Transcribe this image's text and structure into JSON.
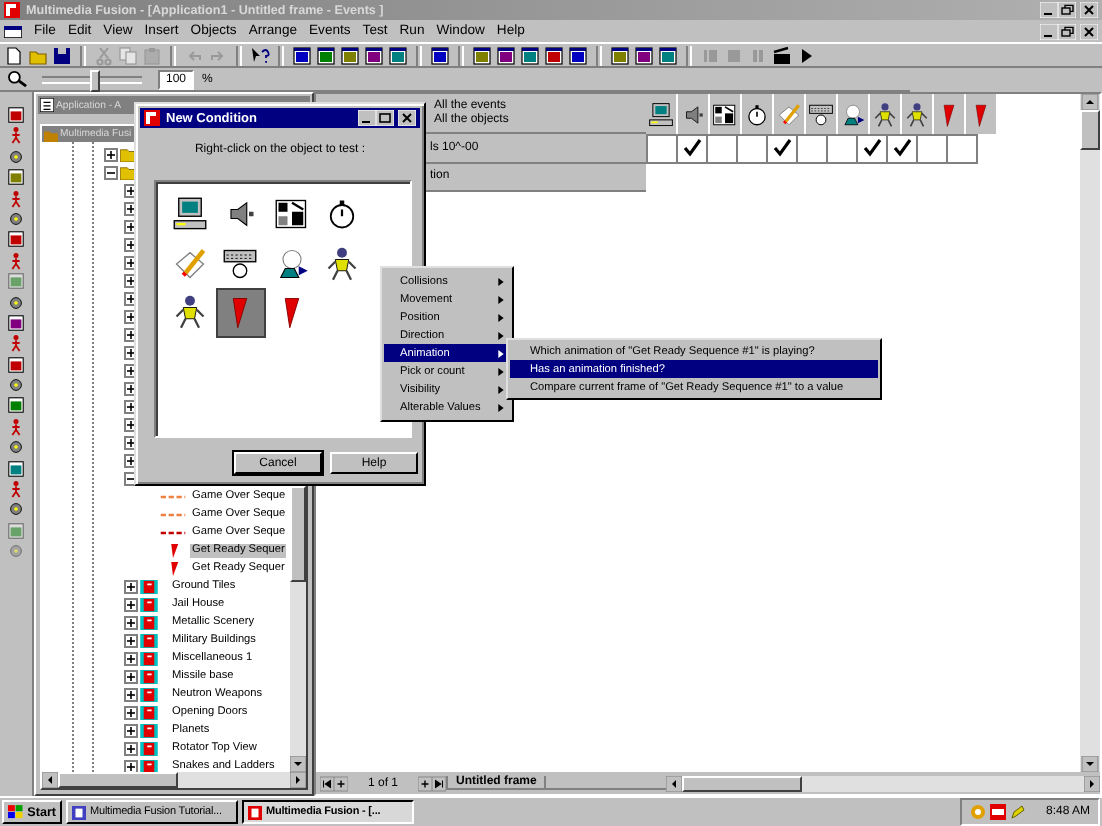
{
  "window": {
    "title": "Multimedia Fusion - [Application1 - Untitled frame - Events ]"
  },
  "menu": [
    "File",
    "Edit",
    "View",
    "Insert",
    "Objects",
    "Arrange",
    "Events",
    "Test",
    "Run",
    "Window",
    "Help"
  ],
  "zoom": {
    "level": 0.52,
    "value": "100",
    "unit": "%"
  },
  "app_window": {
    "title": "Application - A",
    "inner_title": "Multimedia Fusi",
    "tree": [
      {
        "expanded": false
      },
      {
        "expanded": true,
        "children": [
          {
            "expanded": false
          },
          {
            "expanded": false
          },
          {
            "expanded": false
          },
          {
            "expanded": false
          },
          {
            "expanded": false
          },
          {
            "expanded": false
          },
          {
            "expanded": false
          },
          {
            "expanded": false
          },
          {
            "expanded": false
          },
          {
            "expanded": false
          },
          {
            "expanded": false
          },
          {
            "expanded": false
          },
          {
            "expanded": false
          },
          {
            "expanded": false
          },
          {
            "expanded": false
          },
          {
            "expanded": false
          },
          {
            "expanded": true,
            "children": [
              {
                "label": "Game Over Seque",
                "selected": false
              },
              {
                "label": "Game Over Seque",
                "selected": false
              },
              {
                "label": "Game Over Seque",
                "selected": false
              },
              {
                "label": "Get Ready Sequer",
                "selected": true
              },
              {
                "label": "Get Ready Sequer",
                "selected": false
              }
            ]
          },
          {
            "label": "Ground Tiles",
            "expanded": false
          },
          {
            "label": "Jail House",
            "expanded": false
          },
          {
            "label": "Metallic Scenery",
            "expanded": false
          },
          {
            "label": "Military Buildings",
            "expanded": false
          },
          {
            "label": "Miscellaneous 1",
            "expanded": false
          },
          {
            "label": "Missile base",
            "expanded": false
          },
          {
            "label": "Neutron Weapons",
            "expanded": false
          },
          {
            "label": "Opening Doors",
            "expanded": false
          },
          {
            "label": "Planets",
            "expanded": false
          },
          {
            "label": "Rotator Top View",
            "expanded": false
          },
          {
            "label": "Snakes and Ladders",
            "expanded": false
          }
        ]
      }
    ]
  },
  "event_editor": {
    "header": [
      "All the events",
      "All the objects"
    ],
    "objects": [
      {
        "kind": "computer"
      },
      {
        "kind": "speaker"
      },
      {
        "kind": "storyboard"
      },
      {
        "kind": "timer"
      },
      {
        "kind": "pencil"
      },
      {
        "kind": "keyboard"
      },
      {
        "kind": "player"
      },
      {
        "kind": "figure"
      },
      {
        "kind": "figure"
      },
      {
        "kind": "flag"
      },
      {
        "kind": "flag"
      }
    ],
    "rows": [
      {
        "text": "ls 10^-00",
        "cells": [
          {
            "checked": false
          },
          {
            "checked": true
          },
          {
            "checked": false
          },
          {
            "checked": false
          },
          {
            "checked": true
          },
          {
            "checked": false
          },
          {
            "checked": false
          },
          {
            "checked": true
          },
          {
            "checked": true
          },
          {
            "checked": false
          },
          {
            "checked": false
          }
        ]
      },
      {
        "text": "tion"
      }
    ],
    "page": "1 of 1",
    "frame_tab": "Untitled frame"
  },
  "dialog": {
    "title": "New Condition",
    "prompt": "Right-click on the object to test :",
    "objects": [
      {
        "kind": "computer",
        "selected": false
      },
      {
        "kind": "speaker",
        "selected": false
      },
      {
        "kind": "storyboard",
        "selected": false
      },
      {
        "kind": "timer",
        "selected": false
      },
      {
        "kind": "pencil",
        "selected": false
      },
      {
        "kind": "keyboard",
        "selected": false
      },
      {
        "kind": "player",
        "selected": false
      },
      {
        "kind": "figure",
        "selected": false
      },
      {
        "kind": "figure",
        "selected": false
      },
      {
        "kind": "flag",
        "selected": true
      },
      {
        "kind": "flag",
        "selected": false
      }
    ],
    "buttons": [
      "Cancel",
      "Help"
    ]
  },
  "context_menu": [
    {
      "label": "Collisions",
      "selected": false
    },
    {
      "label": "Movement",
      "selected": false
    },
    {
      "label": "Position",
      "selected": false
    },
    {
      "label": "Direction",
      "selected": false
    },
    {
      "label": "Animation",
      "selected": true
    },
    {
      "label": "Pick or count",
      "selected": false
    },
    {
      "label": "Visibility",
      "selected": false
    },
    {
      "label": "Alterable Values",
      "selected": false
    }
  ],
  "submenu": [
    {
      "label": "Which animation of \"Get Ready Sequence #1\" is playing?",
      "selected": false
    },
    {
      "label": "Has an animation finished?",
      "selected": true
    },
    {
      "label": "Compare current frame of \"Get Ready Sequence #1\" to a value",
      "selected": false
    }
  ],
  "taskbar": {
    "start": "Start",
    "tasks": [
      {
        "label": "Multimedia Fusion Tutorial...",
        "selected": false
      },
      {
        "label": "Multimedia Fusion - [...",
        "selected": true
      }
    ],
    "clock": "8:48 AM"
  }
}
